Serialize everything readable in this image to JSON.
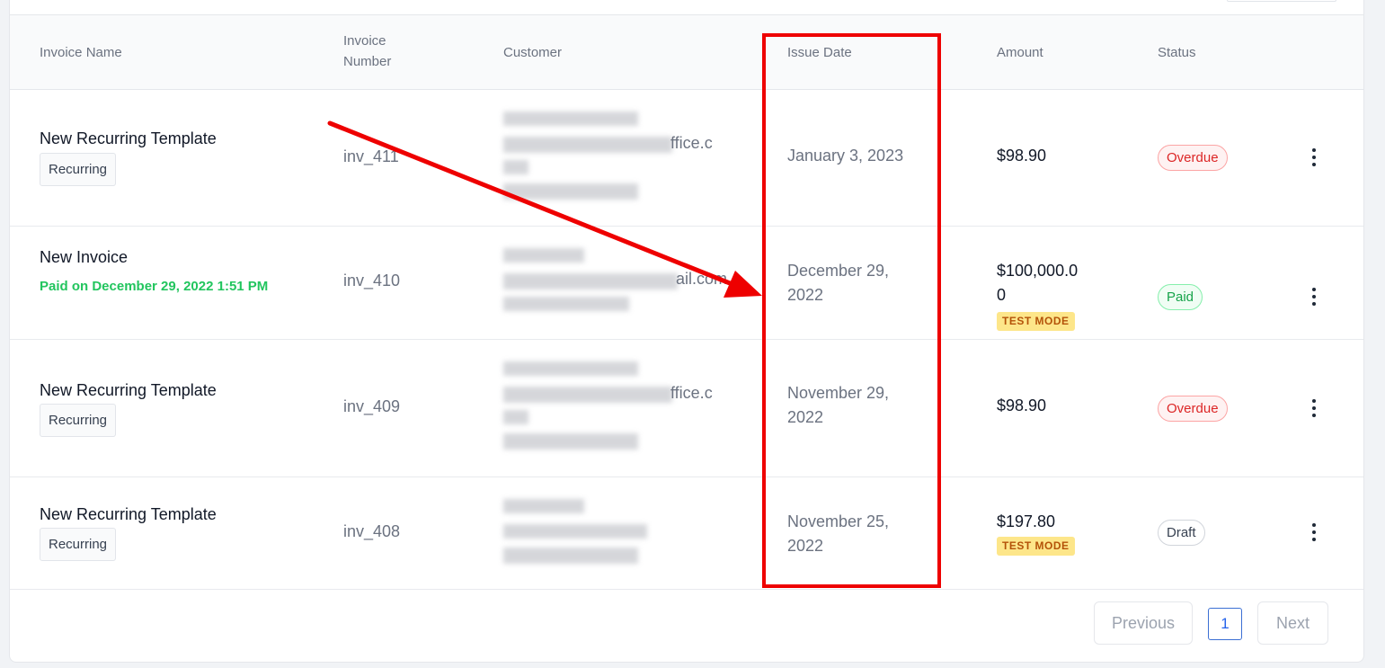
{
  "table": {
    "headers": {
      "invoice_name": "Invoice Name",
      "invoice_number_line1": "Invoice",
      "invoice_number_line2": "Number",
      "customer": "Customer",
      "issue_date": "Issue Date",
      "amount": "Amount",
      "status": "Status"
    },
    "rows": [
      {
        "name": "New Recurring Template",
        "tag": "Recurring",
        "number": "inv_411",
        "customer_visible": [
          "ffice.c"
        ],
        "date_line1": "January 3, 2023",
        "date_line2": "",
        "amount_line1": "$98.90",
        "amount_line2": "",
        "status": "Overdue"
      },
      {
        "name": "New Invoice",
        "paid_note": "Paid on December 29, 2022 1:51 PM",
        "number": "inv_410",
        "customer_visible": [
          "ail.com"
        ],
        "date_line1": "December 29,",
        "date_line2": "2022",
        "amount_line1": "$100,000.0",
        "amount_line2": "0",
        "test_mode": "TEST MODE",
        "status": "Paid"
      },
      {
        "name": "New Recurring Template",
        "tag": "Recurring",
        "number": "inv_409",
        "customer_visible": [
          "ffice.c"
        ],
        "date_line1": "November 29,",
        "date_line2": "2022",
        "amount_line1": "$98.90",
        "amount_line2": "",
        "status": "Overdue"
      },
      {
        "name": "New Recurring Template",
        "tag": "Recurring",
        "number": "inv_408",
        "customer_visible": [],
        "date_line1": "November 25,",
        "date_line2": "2022",
        "amount_line1": "$197.80",
        "amount_line2": "",
        "test_mode": "TEST MODE",
        "status": "Draft"
      }
    ]
  },
  "pagination": {
    "previous": "Previous",
    "current_page": "1",
    "next": "Next"
  },
  "annotation": {
    "color": "#ee0000"
  },
  "colors": {
    "overdue": "#dc2626",
    "paid": "#16a34a",
    "test_mode_bg": "#fde68a",
    "paid_note": "#22c55e"
  },
  "icons": {
    "row_menu": "more-vertical-icon"
  }
}
